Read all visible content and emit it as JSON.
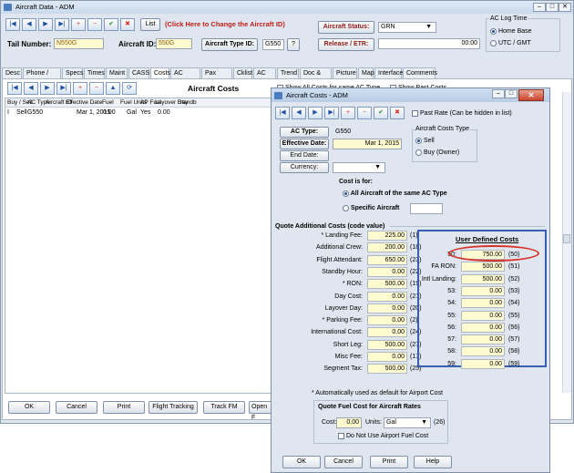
{
  "main": {
    "title": "Aircraft Data - ADM",
    "nav_buttons": [
      "|◀",
      "◀",
      "▶",
      "▶|",
      "+",
      "−",
      "✔",
      "✖"
    ],
    "list_label": "List",
    "change_aircraft_text": "(Click Here to Change the Aircraft ID)",
    "status_label": "Aircraft Status:",
    "status_value": "GRN",
    "log_time_label": "AC Log Time",
    "log_home": "Home Base",
    "log_utc": "UTC / GMT",
    "tail_label": "Tail Number:",
    "tail_value": "N550G",
    "aircraft_id_label": "Aircraft ID:",
    "aircraft_id_value": "550G",
    "type_id_label": "Aircraft Type ID:",
    "type_id_value": "G550",
    "type_id_help": "?",
    "release_label": "Release / ETR:",
    "release_time": "00:00",
    "tabs": [
      "Desc",
      "Phone / Dates",
      "Specs",
      "Times",
      "Maint",
      "CASS",
      "Costs",
      "AC Rates",
      "Pax Rates",
      "Cklist",
      "AC Log",
      "Trend",
      "Doc & Exp",
      "Picture",
      "Map",
      "Interface",
      "Comments"
    ],
    "subnav": [
      "|◀",
      "◀",
      "▶",
      "▶|",
      "+",
      "−",
      "▲",
      "⟳"
    ],
    "section_title": "Aircraft Costs",
    "show_all_label": "Show All Costs for same AC Type",
    "show_past_label": "Show Past Costs",
    "grid_headers": [
      "Buy / Sell",
      "AC Type",
      "Aircraft ID",
      "Effective Date",
      "Fuel",
      "Fuel Units",
      "AP Fuel",
      "Layover Day",
      "Standb"
    ],
    "grid_row": [
      "I",
      "Sell",
      "G550",
      "",
      "Mar 1, 2015",
      "0.00",
      "Gal",
      "Yes",
      "0.00"
    ],
    "bottom_buttons": [
      "OK",
      "Cancel",
      "Print",
      "Flight Tracking",
      "Track FM",
      "Open F"
    ]
  },
  "dialog": {
    "title": "Aircraft Costs - ADM",
    "nav_buttons": [
      "|◀",
      "◀",
      "▶",
      "▶|",
      "+",
      "−",
      "✔",
      "✖"
    ],
    "past_rate_label": "Past Rate (Can be hidden in list)",
    "ac_type_label": "AC Type:",
    "ac_type_value": "G550",
    "effective_label": "Effective Date:",
    "effective_value": "Mar 1, 2015",
    "end_label": "End Date:",
    "currency_label": "Currency:",
    "costs_type_label": "Aircraft Costs Type",
    "sell_label": "Sell",
    "buy_label": "Buy (Owner)",
    "cost_for_label": "Cost is for:",
    "all_aircraft_label": "All Aircraft of the same AC Type",
    "specific_label": "Specific Aircraft",
    "quote_title": "Quote Additional Costs  (code value)",
    "quote_rows": [
      {
        "label": "* Landing Fee:",
        "value": "225.00",
        "code": "(1)"
      },
      {
        "label": "Additional Crew:",
        "value": "200.00",
        "code": "(18)"
      },
      {
        "label": "Flight Attendant:",
        "value": "650.00",
        "code": "(23)"
      },
      {
        "label": "Standby Hour:",
        "value": "0.00",
        "code": "(22)"
      },
      {
        "label": "* RON:",
        "value": "500.00",
        "code": "(19)"
      },
      {
        "label": "Day Cost:",
        "value": "0.00",
        "code": "(21)"
      },
      {
        "label": "Layover Day:",
        "value": "0.00",
        "code": "(20)"
      },
      {
        "label": "* Parking Fee:",
        "value": "0.00",
        "code": "(2)"
      },
      {
        "label": "International Cost:",
        "value": "0.00",
        "code": "(24)"
      },
      {
        "label": "Short Leg:",
        "value": "500.00",
        "code": "(27)"
      },
      {
        "label": "Misc Fee:",
        "value": "0.00",
        "code": "(17)"
      },
      {
        "label": "Segment Tax:",
        "value": "500.00",
        "code": "(25)"
      }
    ],
    "user_title": "User Defined Costs",
    "user_rows": [
      {
        "label": "50:",
        "value": "750.00",
        "code": "(50)"
      },
      {
        "label": "FA RON:",
        "value": "500.00",
        "code": "(51)"
      },
      {
        "label": "Intl Landing:",
        "value": "500.00",
        "code": "(52)"
      },
      {
        "label": "53:",
        "value": "0.00",
        "code": "(53)"
      },
      {
        "label": "54:",
        "value": "0.00",
        "code": "(54)"
      },
      {
        "label": "55:",
        "value": "0.00",
        "code": "(55)"
      },
      {
        "label": "56:",
        "value": "0.00",
        "code": "(56)"
      },
      {
        "label": "57:",
        "value": "0.00",
        "code": "(57)"
      },
      {
        "label": "58:",
        "value": "0.00",
        "code": "(58)"
      },
      {
        "label": "59:",
        "value": "0.00",
        "code": "(59)"
      }
    ],
    "auto_note": "* Automatically used as default for Airport Cost",
    "fuel_title": "Quote Fuel Cost for Aircraft Rates",
    "cost_label": "Cost:",
    "cost_value": "0.00",
    "units_label": "Units:",
    "units_value": "Gal",
    "fuel_code": "(26)",
    "no_airport_fuel_label": "Do Not Use Airport Fuel Cost",
    "buttons": [
      "OK",
      "Cancel",
      "Print",
      "Help"
    ]
  },
  "colors": {
    "highlight_ellipse": "#d9342b",
    "user_box_border": "#3b5fb0",
    "field_yellow": "#fffbd0"
  }
}
